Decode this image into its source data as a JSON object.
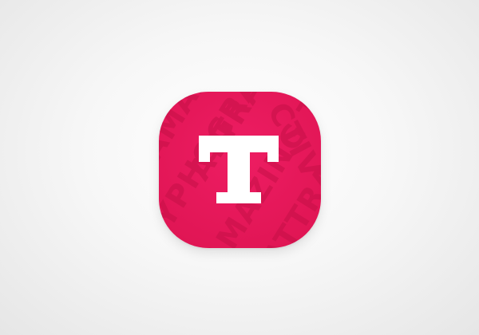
{
  "icon": {
    "name": "t-letter-app-icon",
    "glyph": "T",
    "background_color": "#e6175a",
    "texture_color": "#c81149",
    "glyph_color": "#ffffff",
    "texture_words": [
      "AMAZING",
      "ATTRACT",
      "GRAPHY",
      "TYPHOGRAPHY",
      "AMAZING TYPO",
      "ATTRACT"
    ]
  }
}
